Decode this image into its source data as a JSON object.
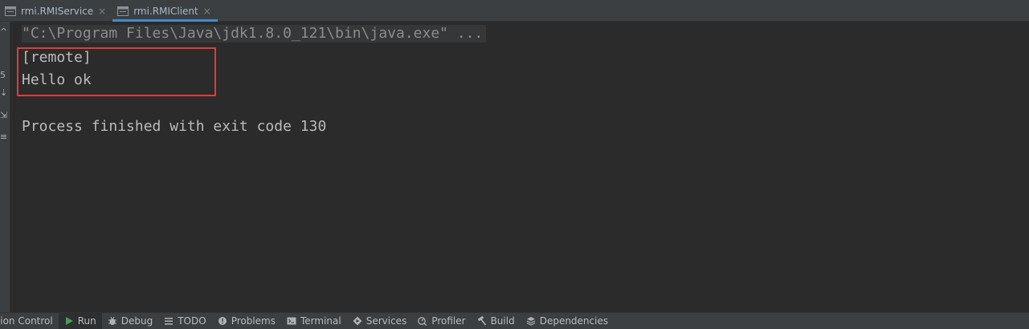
{
  "tabs": [
    {
      "label": "rmi.RMIService",
      "active": false,
      "icon": "run-config-icon"
    },
    {
      "label": "rmi.RMIClient",
      "active": true,
      "icon": "run-config-icon"
    }
  ],
  "gutter": {
    "glyphs": [
      "^",
      "5",
      "⇣",
      "⇲",
      "≡"
    ]
  },
  "console": {
    "command_line": "\"C:\\Program Files\\Java\\jdk1.8.0_121\\bin\\java.exe\" ...",
    "output_lines": [
      "[remote]",
      "Hello ok"
    ],
    "exit_message": "Process finished with exit code 130",
    "highlight_color": "#e03b3b"
  },
  "bottom_bar": {
    "items": [
      {
        "label": "sion Control",
        "icon": ""
      },
      {
        "label": "Run",
        "icon": "run-icon",
        "active": true
      },
      {
        "label": "Debug",
        "icon": "bug-icon"
      },
      {
        "label": "TODO",
        "icon": "list-icon"
      },
      {
        "label": "Problems",
        "icon": "problems-icon"
      },
      {
        "label": "Terminal",
        "icon": "terminal-icon"
      },
      {
        "label": "Services",
        "icon": "services-icon"
      },
      {
        "label": "Profiler",
        "icon": "profiler-icon"
      },
      {
        "label": "Build",
        "icon": "hammer-icon"
      },
      {
        "label": "Dependencies",
        "icon": "layers-icon"
      }
    ]
  },
  "colors": {
    "editor_bg": "#2b2b2b",
    "panel_bg": "#3c3f41",
    "text": "#bbbbbb",
    "active_tab_underline": "#4a88c7",
    "run_green": "#499c54"
  }
}
